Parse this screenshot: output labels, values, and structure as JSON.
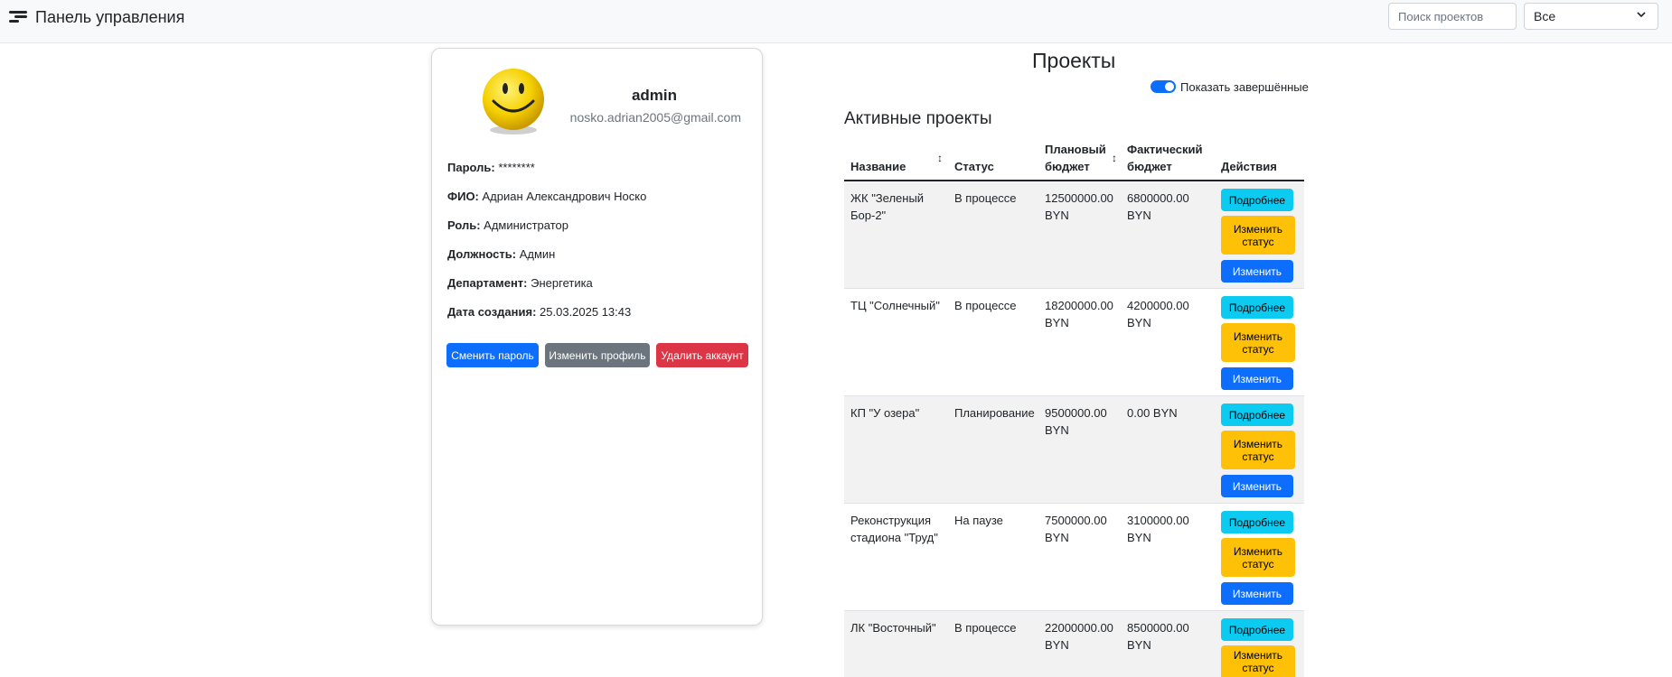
{
  "navbar": {
    "brand": "Панель управления",
    "search_placeholder": "Поиск проектов",
    "filter_value": "Все"
  },
  "profile": {
    "username": "admin",
    "email": "nosko.adrian2005@gmail.com",
    "fields": [
      {
        "label": "Пароль:",
        "value": "********"
      },
      {
        "label": "ФИО:",
        "value": "Адриан Александрович Носко"
      },
      {
        "label": "Роль:",
        "value": "Администратор"
      },
      {
        "label": "Должность:",
        "value": "Админ"
      },
      {
        "label": "Департамент:",
        "value": "Энергетика"
      },
      {
        "label": "Дата создания:",
        "value": "25.03.2025 13:43"
      }
    ],
    "buttons": {
      "change_password": "Сменить пароль",
      "edit_profile": "Изменить профиль",
      "delete_account": "Удалить аккаунт"
    }
  },
  "projects": {
    "title": "Проекты",
    "show_completed_label": "Показать завершённые",
    "show_completed": true,
    "section_title": "Активные проекты",
    "columns": [
      "Название",
      "Статус",
      "Плановый бюджет",
      "Фактический бюджет",
      "Действия"
    ],
    "action_labels": {
      "details": "Подробнее",
      "change_status": "Изменить статус",
      "edit": "Изменить"
    },
    "rows": [
      {
        "name": "ЖК \"Зеленый Бор-2\"",
        "status": "В процессе",
        "planned": "12500000.00 BYN",
        "actual": "6800000.00 BYN"
      },
      {
        "name": "ТЦ \"Солнечный\"",
        "status": "В процессе",
        "planned": "18200000.00 BYN",
        "actual": "4200000.00 BYN"
      },
      {
        "name": "КП \"У озера\"",
        "status": "Планирование",
        "planned": "9500000.00 BYN",
        "actual": "0.00 BYN"
      },
      {
        "name": "Реконструкция стадиона \"Труд\"",
        "status": "На паузе",
        "planned": "7500000.00 BYN",
        "actual": "3100000.00 BYN"
      },
      {
        "name": "ЛК \"Восточный\"",
        "status": "В процессе",
        "planned": "22000000.00 BYN",
        "actual": "8500000.00 BYN"
      }
    ]
  },
  "colors": {
    "primary": "#0d6efd",
    "secondary": "#6c757d",
    "danger": "#dc3545",
    "info": "#0dcaf0",
    "warning": "#ffc107"
  },
  "icons": [
    "menu-icon",
    "smiley-avatar-icon",
    "chevron-down-icon",
    "sort-icon",
    "toggle-switch"
  ]
}
